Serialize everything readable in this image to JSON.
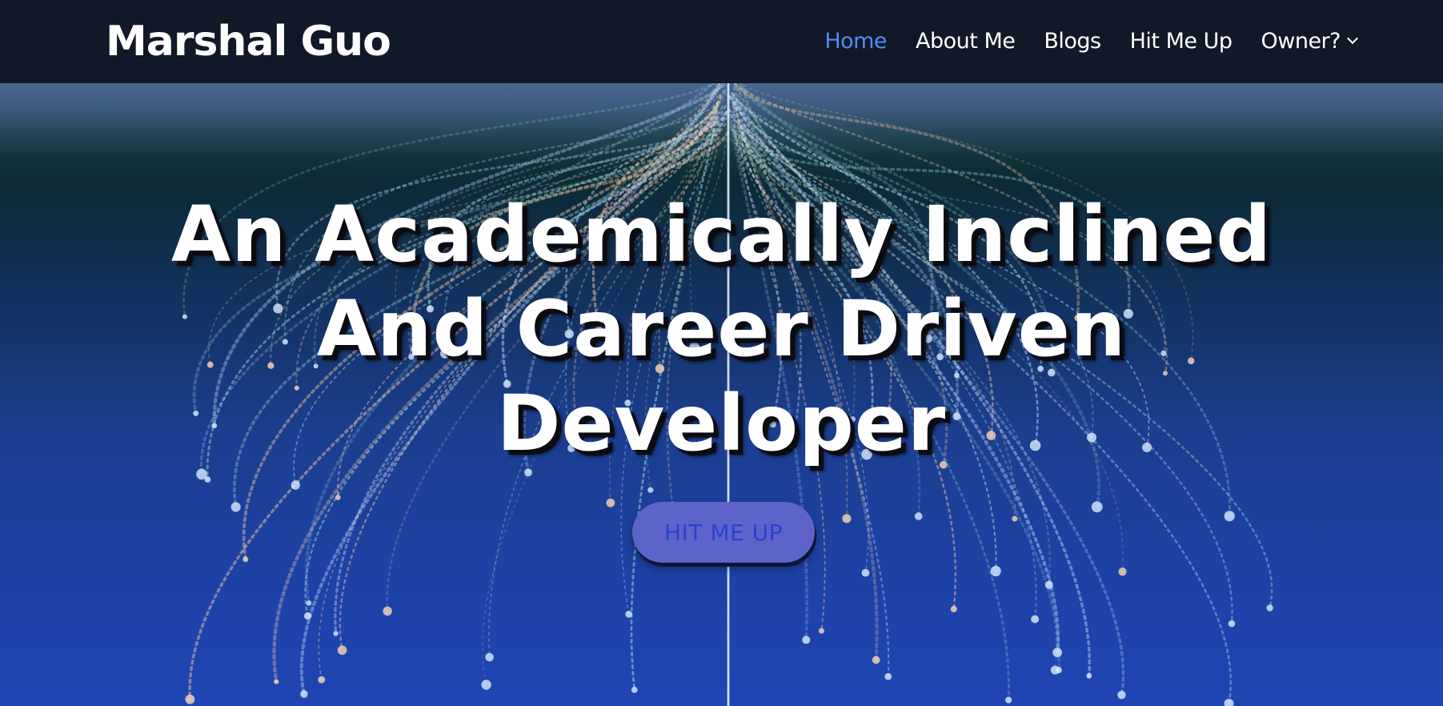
{
  "header": {
    "brand": "Marshal Guo",
    "nav": [
      {
        "label": "Home",
        "active": true
      },
      {
        "label": "About Me",
        "active": false
      },
      {
        "label": "Blogs",
        "active": false
      },
      {
        "label": "Hit Me Up",
        "active": false
      },
      {
        "label": "Owner?",
        "active": false,
        "has_dropdown": true
      }
    ]
  },
  "hero": {
    "title_lines": [
      "An Academically Inclined",
      "And Career Driven",
      "Developer"
    ],
    "cta_label": "HIT ME UP"
  },
  "colors": {
    "navbar_bg": "#111827",
    "nav_active": "#4f8df5",
    "hero_top": "#0d2a35",
    "hero_bottom": "#1f45b3",
    "cta_bg": "#5e63c9",
    "cta_text": "#2c3fd0"
  },
  "icons": {
    "dropdown": "chevron-down-icon"
  }
}
